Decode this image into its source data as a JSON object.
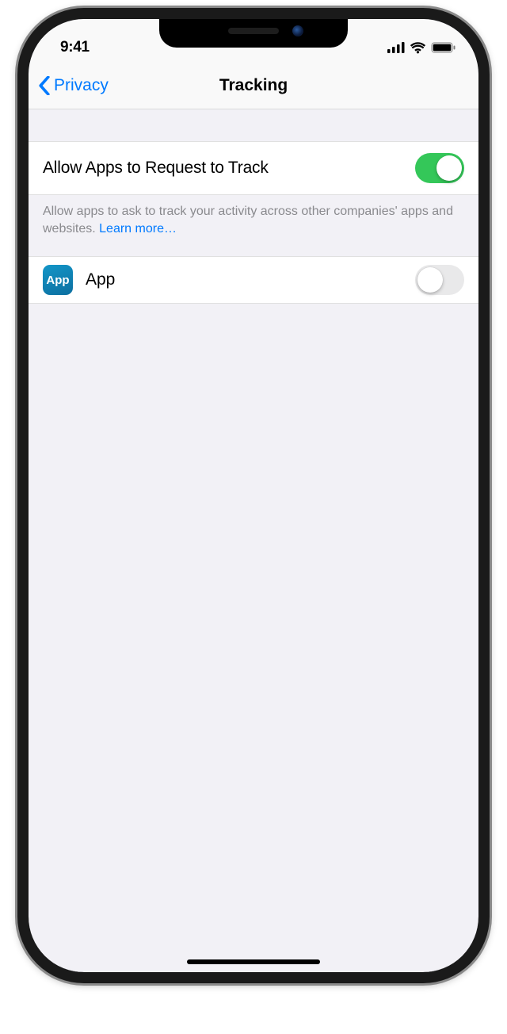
{
  "status": {
    "time": "9:41"
  },
  "nav": {
    "back_label": "Privacy",
    "title": "Tracking"
  },
  "settings": {
    "allow_apps_label": "Allow Apps to Request to Track",
    "allow_apps_on": true,
    "footer_text": "Allow apps to ask to track your activity across other companies' apps and websites. ",
    "learn_more": "Learn more…"
  },
  "apps": [
    {
      "name": "App",
      "icon_text": "App",
      "tracking_on": false
    }
  ]
}
